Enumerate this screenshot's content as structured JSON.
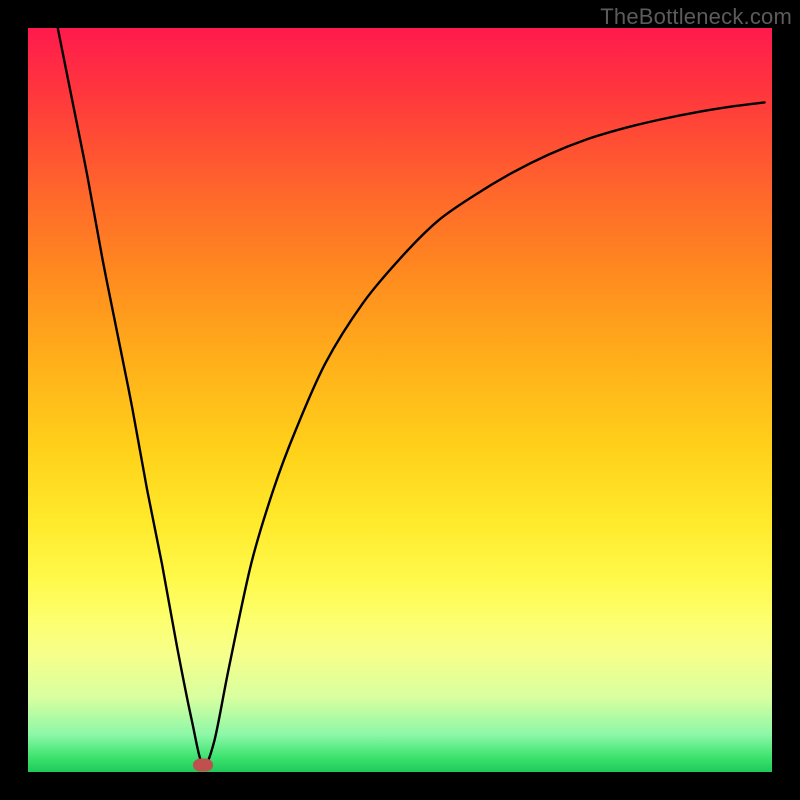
{
  "attribution": "TheBottleneck.com",
  "chart_data": {
    "type": "line",
    "title": "",
    "xlabel": "",
    "ylabel": "",
    "xlim": [
      0,
      100
    ],
    "ylim": [
      0,
      100
    ],
    "series": [
      {
        "name": "curve",
        "x": [
          4,
          6,
          8,
          10,
          12,
          14,
          16,
          18,
          20,
          22,
          23.5,
          25,
          27,
          30,
          33,
          36,
          40,
          45,
          50,
          55,
          60,
          65,
          70,
          75,
          80,
          85,
          90,
          95,
          99
        ],
        "y": [
          100,
          90,
          80,
          69,
          59,
          49,
          38,
          28,
          17,
          7,
          1,
          4,
          14,
          28,
          38,
          46,
          55,
          63,
          69,
          74,
          77.5,
          80.5,
          83,
          85,
          86.5,
          87.7,
          88.7,
          89.5,
          90
        ]
      }
    ],
    "marker": {
      "x": 23.5,
      "y": 1
    },
    "gradient_stops": [
      {
        "pos": 0,
        "color": "#ff1a4d"
      },
      {
        "pos": 50,
        "color": "#ffd21a"
      },
      {
        "pos": 100,
        "color": "#1fc95a"
      }
    ]
  }
}
